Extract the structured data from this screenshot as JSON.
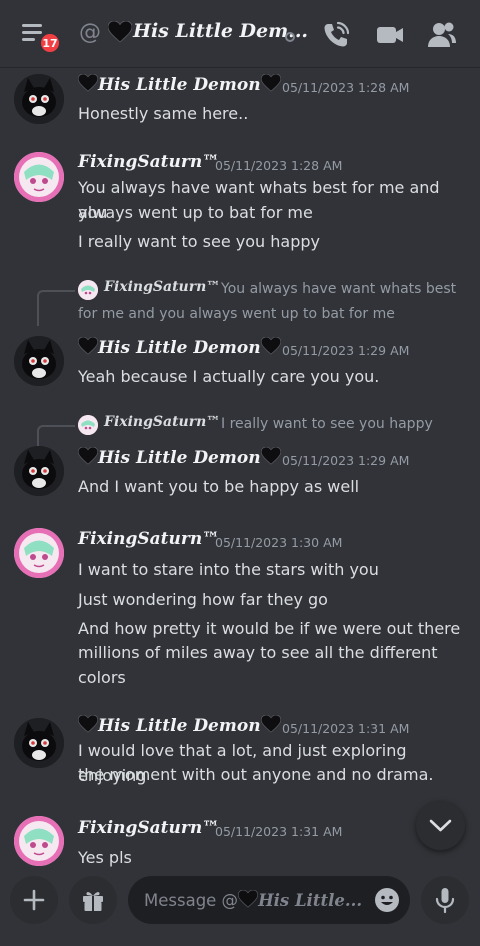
{
  "header": {
    "badge_count": "17",
    "at_symbol": "@",
    "dm_name": "His Little Dem...",
    "dm_heart_icon": "black-heart"
  },
  "messages": [
    {
      "type": "message",
      "author": "His Little Demon",
      "author_hearts": true,
      "time": "05/11/2023 1:28 AM",
      "lines": [
        "Honestly same here.."
      ]
    },
    {
      "type": "message",
      "author": "FixingSaturn™",
      "time": "05/11/2023 1:28 AM",
      "lines": [
        "You always have want whats best for me and you",
        "always went up to bat for me",
        "I really want to see you happy"
      ]
    },
    {
      "type": "reply",
      "reply_author": "FixingSaturn™",
      "reply_text_1": "You always have want whats best",
      "reply_text_2": "for me and you always went up to bat for me",
      "author": "His Little Demon",
      "time": "05/11/2023 1:29 AM",
      "lines": [
        "Yeah because I actually care you you."
      ]
    },
    {
      "type": "reply",
      "reply_author": "FixingSaturn™",
      "reply_text_1": "I really want to see you happy",
      "author": "His Little Demon",
      "time": "05/11/2023 1:29 AM",
      "lines": [
        "And I want you to be happy as well"
      ]
    },
    {
      "type": "message",
      "author": "FixingSaturn™",
      "time": "05/11/2023 1:30 AM",
      "lines": [
        "I want to stare into the stars with you",
        "Just wondering how far they go",
        "And how pretty it would be if we were out there",
        "millions of miles away to see all the different",
        "colors"
      ]
    },
    {
      "type": "message",
      "author": "His Little Demon",
      "time": "05/11/2023 1:31 AM",
      "lines": [
        "I would love that a lot, and just exploring enjoying",
        "the moment with out anyone and no drama."
      ]
    },
    {
      "type": "message",
      "author": "FixingSaturn™",
      "time": "05/11/2023 1:31 AM",
      "lines": [
        "Yes pls"
      ]
    }
  ],
  "composer": {
    "placeholder_prefix": "Message @",
    "placeholder_name": "His Little..."
  },
  "colors": {
    "background": "#313338",
    "text": "#dbdee1",
    "muted": "#949ba4",
    "badge": "#f23f43"
  }
}
